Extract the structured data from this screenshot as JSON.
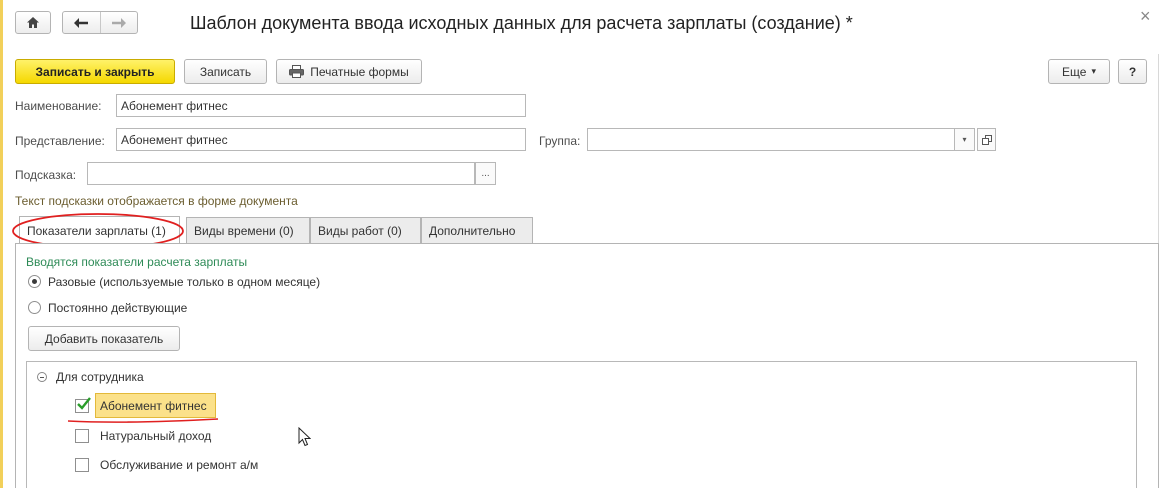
{
  "window": {
    "title": "Шаблон документа ввода исходных данных для расчета зарплаты (создание) *",
    "close_glyph": "×"
  },
  "toolbar": {
    "save_close_label": "Записать и закрыть",
    "save_label": "Записать",
    "print_label": "Печатные формы",
    "more_label": "Еще",
    "more_arrow": "▾",
    "help_label": "?"
  },
  "form": {
    "name_label": "Наименование:",
    "name_value": "Абонемент фитнес",
    "presentation_label": "Представление:",
    "presentation_value": "Абонемент фитнес",
    "group_label": "Группа:",
    "group_value": "",
    "hint_label": "Подсказка:",
    "hint_value": "",
    "hint_button": "...",
    "hint_note": "Текст подсказки отображается в форме документа"
  },
  "tabs": [
    {
      "label": "Показатели зарплаты (1)"
    },
    {
      "label": "Виды времени (0)"
    },
    {
      "label": "Виды работ (0)"
    },
    {
      "label": "Дополнительно"
    }
  ],
  "panel": {
    "heading": "Вводятся показатели расчета зарплаты",
    "radio_once": "Разовые (используемые только в одном месяце)",
    "radio_permanent": "Постоянно действующие",
    "add_button": "Добавить показатель"
  },
  "tree": {
    "group_label": "Для сотрудника",
    "items": [
      {
        "label": "Абонемент фитнес",
        "checked": true
      },
      {
        "label": "Натуральный доход",
        "checked": false
      },
      {
        "label": "Обслуживание и ремонт а/м",
        "checked": false
      }
    ]
  },
  "colors": {
    "primary_button": "#f5d800",
    "heading_green": "#2e8b57",
    "hint_note": "#6b5d2f",
    "annotation_red": "#e02020",
    "selected_item": "#fbe18a",
    "check_green": "#2a9d2a"
  }
}
